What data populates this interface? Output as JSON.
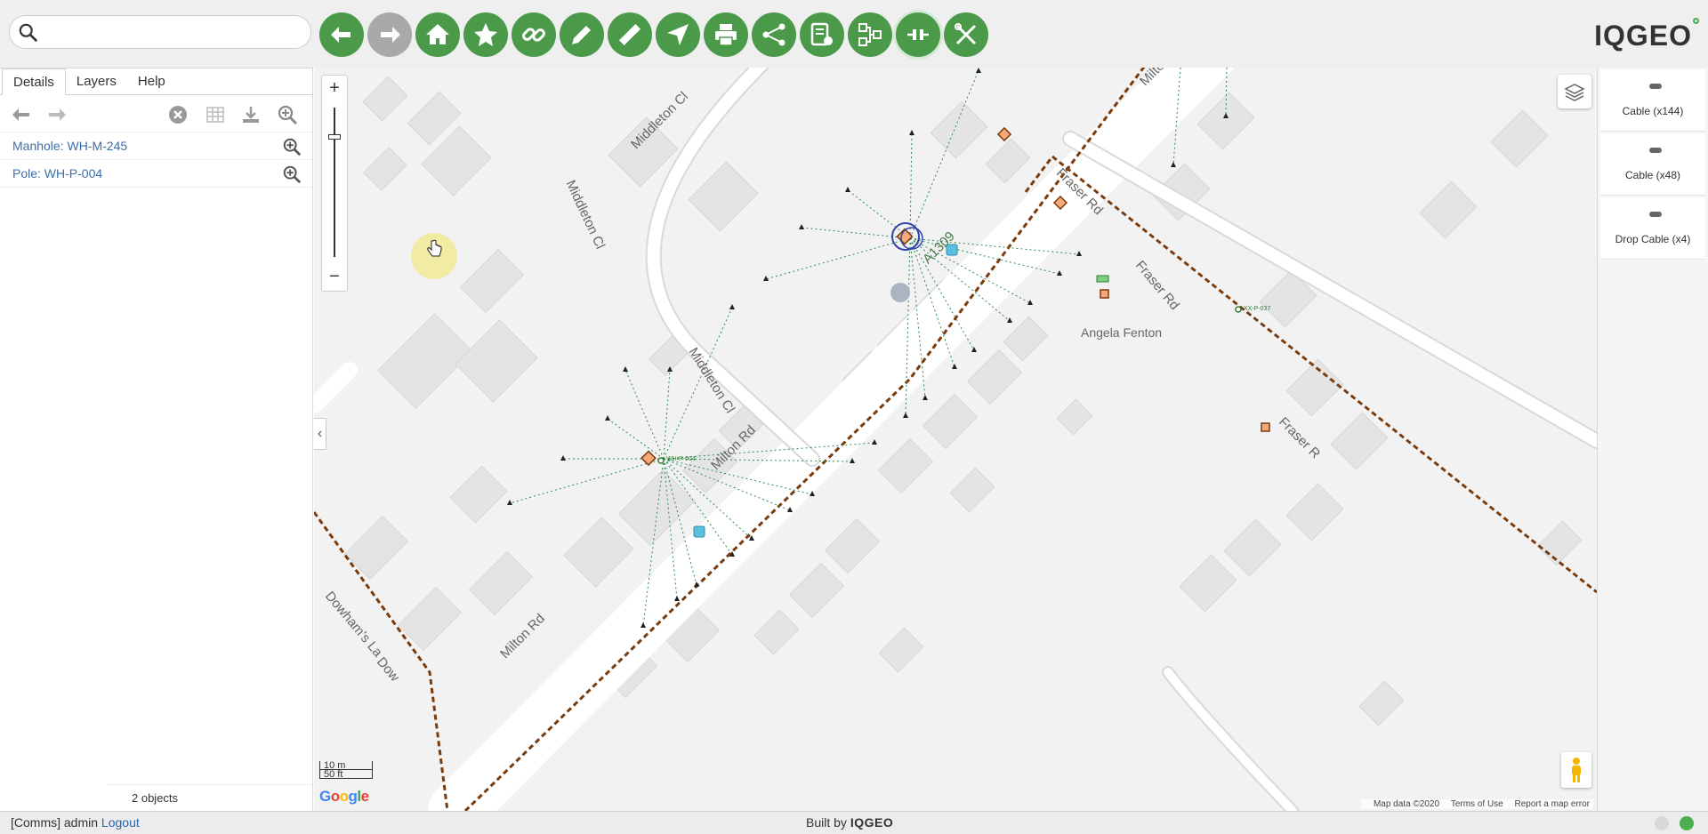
{
  "app": {
    "logo": "IQGEO"
  },
  "search": {
    "placeholder": ""
  },
  "toolbar": {
    "tools": [
      "back-icon",
      "forward-icon",
      "home-icon",
      "bookmark-icon",
      "link-icon",
      "edit-icon",
      "measure-icon",
      "directions-icon",
      "print-icon",
      "share-icon",
      "report-settings-icon",
      "network-trace-icon",
      "connection-icon",
      "tools-icon"
    ]
  },
  "left_panel": {
    "tabs": [
      {
        "label": "Details",
        "active": true
      },
      {
        "label": "Layers",
        "active": false
      },
      {
        "label": "Help",
        "active": false
      }
    ],
    "results": [
      {
        "label": "Manhole: WH-M-245"
      },
      {
        "label": "Pole: WH-P-004"
      }
    ],
    "count_text": "2 objects"
  },
  "map": {
    "zoom_in": "+",
    "zoom_out": "−",
    "collapse": "‹",
    "streets": {
      "middleton_top": "Middleton Cl",
      "middleton_left": "Middleton Cl",
      "middleton_mid": "Middleton Cl",
      "milton_mid": "Milton Rd",
      "milton_bottom": "Milton Rd",
      "milton_top": "Milto",
      "fraser_top": "Fraser Rd",
      "fraser_mid": "Fraser Rd",
      "fraser_right": "Fraser R",
      "dowham": "Dowham's La",
      "dow": "Dow",
      "a1309": "A1309"
    },
    "poi": "Angela Fenton",
    "scale": {
      "metric": "10 m",
      "imperial": "50 ft"
    },
    "google": "Google",
    "attribution": {
      "data": "Map data ©2020",
      "terms": "Terms of Use",
      "report": "Report a map error"
    },
    "feature_labels": {
      "pole_label": "WH-P-004",
      "pole2_label": "XX-P-037"
    }
  },
  "right_panel": {
    "layers": [
      {
        "label": "Cable (x144)"
      },
      {
        "label": "Cable (x48)"
      },
      {
        "label": "Drop Cable (x4)"
      }
    ]
  },
  "footer": {
    "user_prefix": "[Comms] admin",
    "logout": "Logout",
    "built_by": "Built by",
    "brand": "IQGEO"
  },
  "colors": {
    "tool_green": "#4a9a4a",
    "tool_disabled": "#a9a9a9",
    "link_blue": "#3c6fa8",
    "cable_brown": "#7a3b0c",
    "drop_green": "#2e8b57",
    "status_green": "#4caf50"
  }
}
